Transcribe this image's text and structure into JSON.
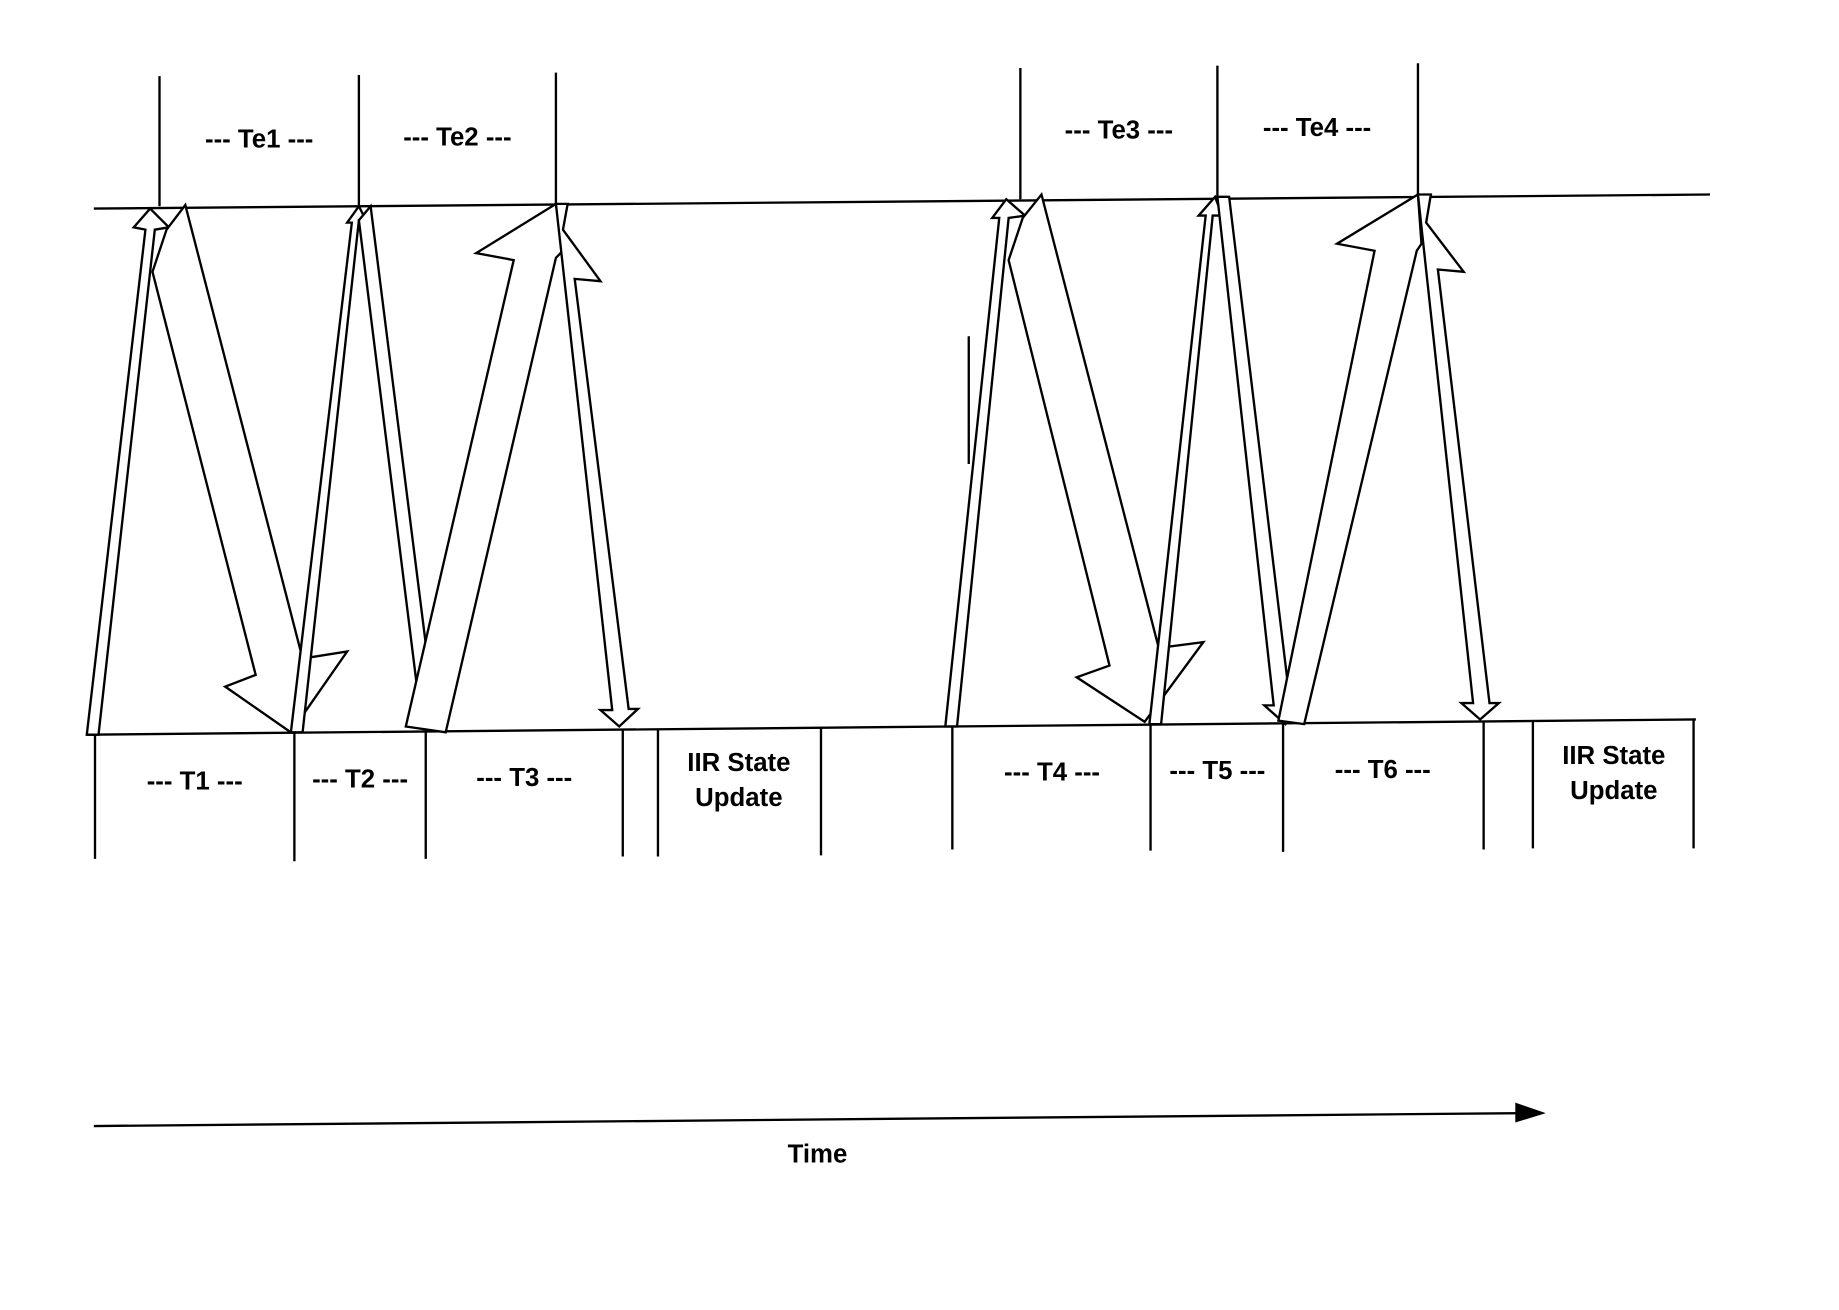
{
  "diagram": {
    "top_labels": [
      "--- Te1 ---",
      "--- Te2 ---",
      "--- Te3 ---",
      "--- Te4 ---"
    ],
    "bottom_labels": [
      "--- T1 ---",
      "--- T2 ---",
      "--- T3 ---",
      "--- T4 ---",
      "--- T5 ---",
      "--- T6 ---"
    ],
    "update_label_line1": "IIR State",
    "update_label_line2": "Update",
    "time_label": "Time"
  }
}
